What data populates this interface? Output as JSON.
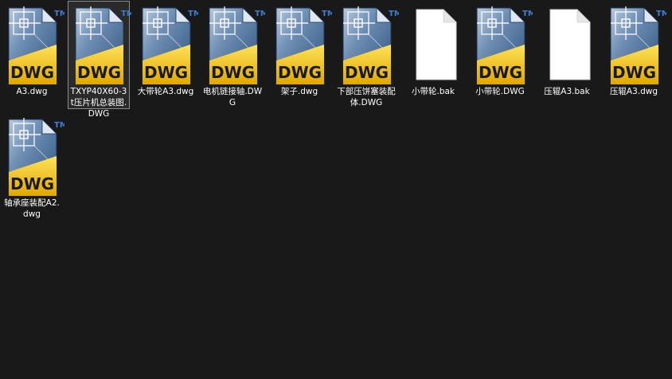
{
  "window": {
    "background": "#191919"
  },
  "icon_types": {
    "dwg": {
      "name": "dwg-file-icon",
      "badge_text": "DWG",
      "tm_text": "TM",
      "accent": "#f2c400",
      "body": "#3c6aa0"
    },
    "bak": {
      "name": "bak-file-icon"
    }
  },
  "files": [
    {
      "name": "A3.dwg",
      "type": "dwg",
      "selected": false
    },
    {
      "name": "TXYP40X60-3t压片机总装图.DWG",
      "type": "dwg",
      "selected": true
    },
    {
      "name": "大带轮A3.dwg",
      "type": "dwg",
      "selected": false
    },
    {
      "name": "电机链接轴.DWG",
      "type": "dwg",
      "selected": false
    },
    {
      "name": "架子.dwg",
      "type": "dwg",
      "selected": false
    },
    {
      "name": "下部压饼塞装配体.DWG",
      "type": "dwg",
      "selected": false
    },
    {
      "name": "小带轮.bak",
      "type": "bak",
      "selected": false
    },
    {
      "name": "小带轮.DWG",
      "type": "dwg",
      "selected": false
    },
    {
      "name": "压辊A3.bak",
      "type": "bak",
      "selected": false
    },
    {
      "name": "压辊A3.dwg",
      "type": "dwg",
      "selected": false
    },
    {
      "name": "轴承座装配A2.dwg",
      "type": "dwg",
      "selected": false
    }
  ]
}
